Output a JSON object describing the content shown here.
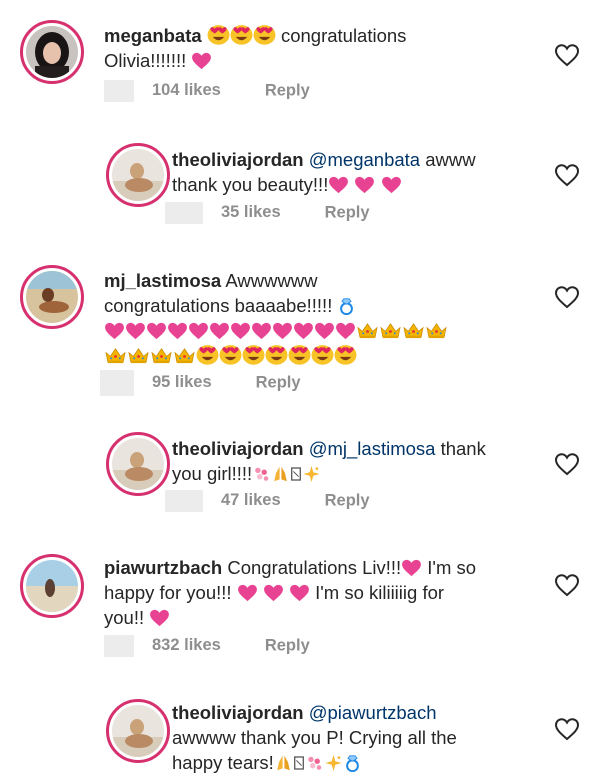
{
  "comments": [
    {
      "username": "meganbata",
      "text_a": "",
      "text_b": " congratulations",
      "text_c": "Olivia!!!!!!!",
      "likes": "104 likes",
      "reply": "Reply"
    },
    {
      "username": "theoliviajordan",
      "mention": "@meganbata",
      "text_a": " awww",
      "text_b": "thank you beauty!!!",
      "likes": "35 likes",
      "reply": "Reply"
    },
    {
      "username": "mj_lastimosa",
      "text_a": " Awwwwww",
      "text_b": "congratulations baaaabe!!!!!",
      "likes": "95 likes",
      "reply": "Reply"
    },
    {
      "username": "theoliviajordan",
      "mention": "@mj_lastimosa",
      "text_a": " thank",
      "text_b": "you girl!!!!",
      "likes": "47 likes",
      "reply": "Reply"
    },
    {
      "username": "piawurtzbach",
      "text_a": " Congratulations Liv!!!",
      "text_b": " I'm so",
      "text_c": "happy for you!!!",
      "text_d": " I'm so kiliiiiig for",
      "text_e": "you!!",
      "likes": "832 likes",
      "reply": "Reply"
    },
    {
      "username": "theoliviajordan",
      "mention": "@piawurtzbach",
      "text_a": "awwww thank you P! Crying all the",
      "text_b": "happy tears!",
      "likes": "",
      "reply": ""
    }
  ],
  "colors": {
    "accent": "#d6306f",
    "heart_emoji": "#e84393",
    "mention": "#003569",
    "meta": "#8e8e8e"
  },
  "icons": [
    "heart-outline-icon",
    "heart-eyes-emoji",
    "crown-emoji",
    "ring-emoji",
    "sparkle-emoji",
    "pray-emoji"
  ]
}
